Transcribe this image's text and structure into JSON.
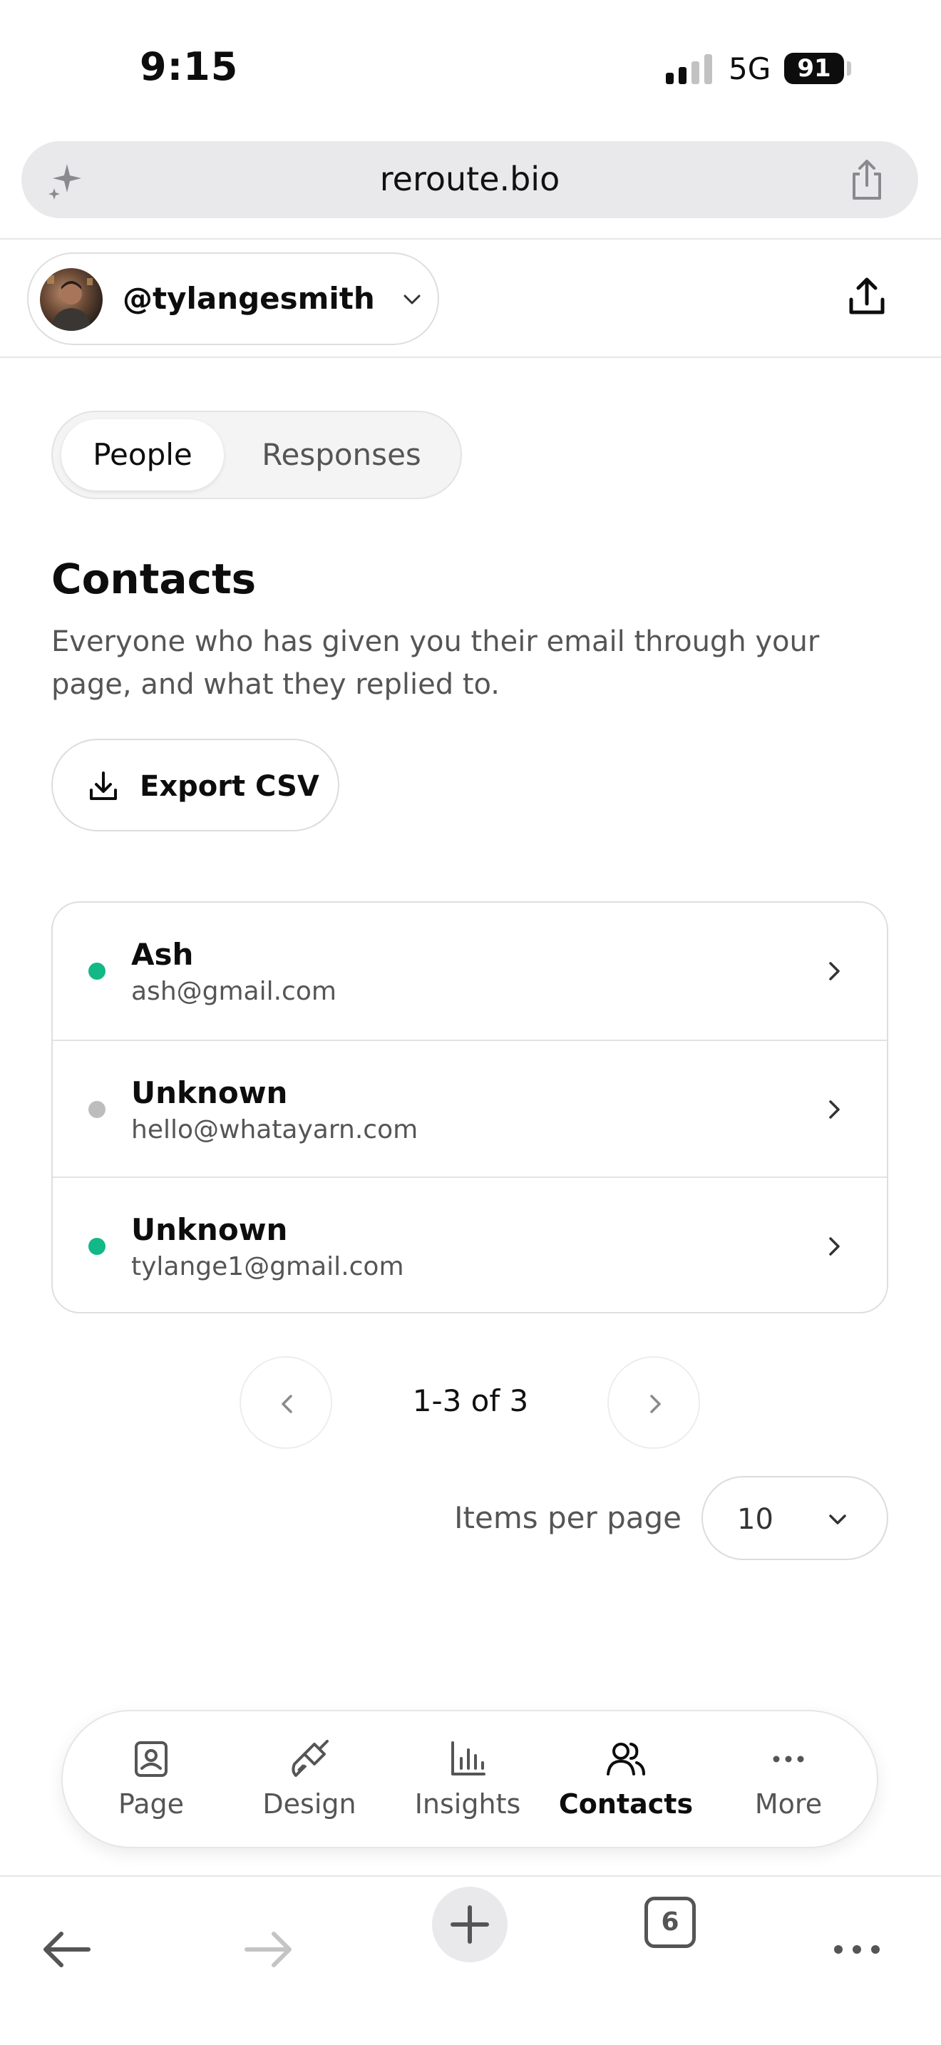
{
  "status_bar": {
    "time": "9:15",
    "network": "5G",
    "battery": "91"
  },
  "browser": {
    "url": "reroute.bio",
    "tab_count": "6"
  },
  "header": {
    "username": "@tylangesmith"
  },
  "segmented": {
    "tabs": [
      {
        "label": "People",
        "active": true
      },
      {
        "label": "Responses",
        "active": false
      }
    ]
  },
  "page": {
    "title": "Contacts",
    "description": "Everyone who has given you their email through your page, and what they replied to.",
    "export_label": "Export CSV"
  },
  "contacts": [
    {
      "name": "Ash",
      "email": "ash@gmail.com",
      "status_color": "#12b886"
    },
    {
      "name": "Unknown",
      "email": "hello@whatayarn.com",
      "status_color": "#bdbdbd"
    },
    {
      "name": "Unknown",
      "email": "tylange1@gmail.com",
      "status_color": "#12b886"
    }
  ],
  "pagination": {
    "range": "1-3 of 3",
    "items_per_page_label": "Items per page",
    "items_per_page_value": "10"
  },
  "tabbar": {
    "items": [
      {
        "label": "Page",
        "icon": "page-icon",
        "active": false
      },
      {
        "label": "Design",
        "icon": "brush-icon",
        "active": false
      },
      {
        "label": "Insights",
        "icon": "bar-chart-icon",
        "active": false
      },
      {
        "label": "Contacts",
        "icon": "people-icon",
        "active": true
      },
      {
        "label": "More",
        "icon": "more-icon",
        "active": false
      }
    ]
  },
  "colors": {
    "accent_green": "#12b886",
    "inactive_dot": "#bdbdbd",
    "text_primary": "#0d0d0d",
    "text_secondary": "#555555"
  }
}
